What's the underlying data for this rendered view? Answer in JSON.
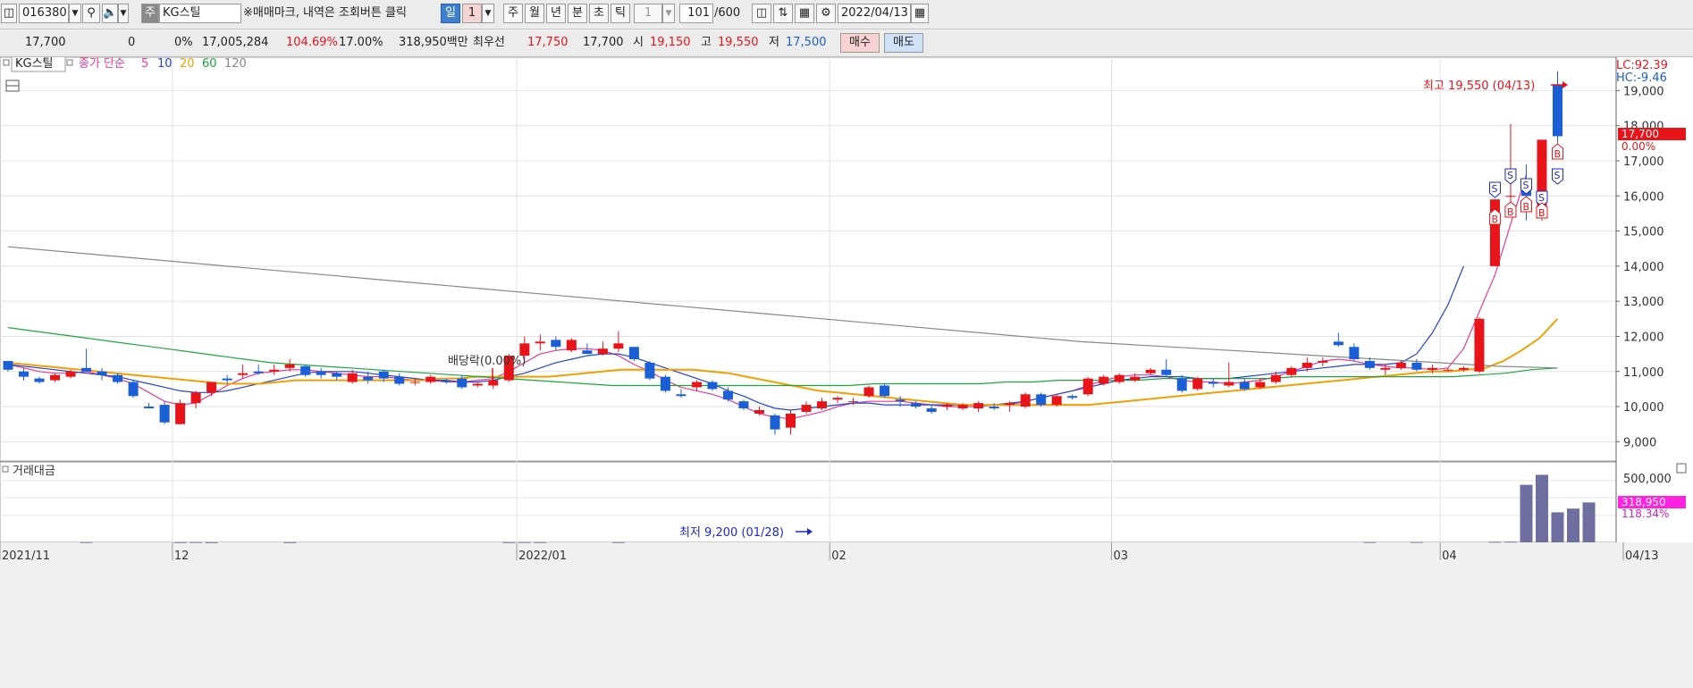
{
  "toolbar": {
    "code": "016380",
    "stock_badge": "주",
    "stock_name": "KG스틸",
    "notice": "※매매마크, 내역은 조회버튼 클릭",
    "periods": [
      "일",
      "1",
      "주",
      "월",
      "년",
      "분",
      "초",
      "틱",
      "1"
    ],
    "count": "101",
    "count_max": "/600",
    "date": "2022/04/13"
  },
  "quote": {
    "price": "17,700",
    "change": "0",
    "change_pct": "0%",
    "volume": "17,005,284",
    "vol_ratio": "104.69%",
    "turnover": "17.00%",
    "amount": "318,950백만",
    "best_label": "최우선",
    "best_ask": "17,750",
    "best_bid": "17,700",
    "open_label": "시",
    "open": "19,150",
    "high_label": "고",
    "high": "19,550",
    "low_label": "저",
    "low": "17,500",
    "buy_label": "매수",
    "sell_label": "매도"
  },
  "legend": {
    "stock": "KG스틸",
    "ma_prefix": "종가 단순",
    "ma": [
      {
        "label": "5",
        "color": "#e6399b"
      },
      {
        "label": "10",
        "color": "#2244cc"
      },
      {
        "label": "20",
        "color": "#f0a000"
      },
      {
        "label": "60",
        "color": "#1aa83a"
      },
      {
        "label": "120",
        "color": "#888888"
      }
    ],
    "volume_title": "거래대금"
  },
  "annotations": {
    "high": "최고 19,550 (04/13)",
    "low": "최저 9,200 (01/28)",
    "dividend": "배당락(0.00%)",
    "lc": "LC:92.39",
    "hc": "HC:-9.46",
    "price_tag": "17,700",
    "price_tag_pct": "0.00%",
    "vol_tag": "318,950",
    "vol_tag_pct": "118.34%"
  },
  "colors": {
    "up": "#e8141a",
    "down": "#1a5fd6",
    "volume": "#6e6ea0"
  },
  "chart_data": {
    "type": "candlestick",
    "y_ticks": [
      "19,000",
      "18,000",
      "17,000",
      "16,000",
      "15,000",
      "14,000",
      "13,000",
      "12,000",
      "11,000",
      "10,000",
      "9,000"
    ],
    "y_tick_values": [
      19000,
      18000,
      17000,
      16000,
      15000,
      14000,
      13000,
      12000,
      11000,
      10000,
      9000
    ],
    "ylim": [
      8500,
      19900
    ],
    "x_labels": [
      {
        "label": "2021/11",
        "index": -1
      },
      {
        "label": "12",
        "index": 11
      },
      {
        "label": "2022/01",
        "index": 33
      },
      {
        "label": "02",
        "index": 53
      },
      {
        "label": "03",
        "index": 71
      },
      {
        "label": "04",
        "index": 92
      },
      {
        "label": "04/13",
        "index": 101
      }
    ],
    "candles": [
      [
        11300,
        11300,
        11000,
        11050
      ],
      [
        11000,
        11100,
        10750,
        10850
      ],
      [
        10800,
        10850,
        10650,
        10700
      ],
      [
        10750,
        10950,
        10700,
        10900
      ],
      [
        10850,
        11050,
        10800,
        11000
      ],
      [
        11100,
        11650,
        11000,
        11000
      ],
      [
        11000,
        11100,
        10750,
        10900
      ],
      [
        10900,
        10950,
        10650,
        10700
      ],
      [
        10700,
        10750,
        10250,
        10300
      ],
      [
        10000,
        10100,
        9950,
        9950
      ],
      [
        10050,
        10150,
        9500,
        9550
      ],
      [
        9500,
        10200,
        9500,
        10100
      ],
      [
        10100,
        10450,
        9950,
        10400
      ],
      [
        10400,
        10700,
        10300,
        10700
      ],
      [
        10800,
        10900,
        10650,
        10750
      ],
      [
        10900,
        11200,
        10800,
        10950
      ],
      [
        11000,
        11200,
        10900,
        10950
      ],
      [
        11000,
        11200,
        10900,
        11050
      ],
      [
        11100,
        11350,
        11000,
        11200
      ],
      [
        11150,
        11200,
        10850,
        10900
      ],
      [
        11000,
        11100,
        10800,
        10900
      ],
      [
        10950,
        11000,
        10750,
        10850
      ],
      [
        10700,
        11050,
        10650,
        10950
      ],
      [
        10850,
        11000,
        10650,
        10750
      ],
      [
        11000,
        11050,
        10700,
        10800
      ],
      [
        10850,
        10950,
        10600,
        10650
      ],
      [
        10700,
        10800,
        10600,
        10700
      ],
      [
        10700,
        10900,
        10650,
        10850
      ],
      [
        10750,
        10800,
        10650,
        10700
      ],
      [
        10800,
        10900,
        10500,
        10550
      ],
      [
        10600,
        10700,
        10550,
        10650
      ],
      [
        10600,
        10800,
        10500,
        10750
      ],
      [
        10750,
        11500,
        10700,
        11450
      ],
      [
        11450,
        12000,
        11350,
        11800
      ],
      [
        11800,
        12050,
        11600,
        11850
      ],
      [
        11900,
        12000,
        11600,
        11700
      ],
      [
        11600,
        11950,
        11550,
        11900
      ],
      [
        11600,
        11800,
        11500,
        11500
      ],
      [
        11500,
        11850,
        11450,
        11650
      ],
      [
        11650,
        12150,
        11550,
        11800
      ],
      [
        11700,
        11700,
        11300,
        11350
      ],
      [
        11250,
        11300,
        10750,
        10800
      ],
      [
        10850,
        10900,
        10400,
        10450
      ],
      [
        10350,
        10500,
        10250,
        10300
      ],
      [
        10550,
        10750,
        10450,
        10700
      ],
      [
        10700,
        10750,
        10450,
        10500
      ],
      [
        10450,
        10550,
        10150,
        10200
      ],
      [
        10150,
        10200,
        9900,
        9950
      ],
      [
        9800,
        10000,
        9750,
        9900
      ],
      [
        9750,
        9800,
        9200,
        9350
      ],
      [
        9400,
        9900,
        9200,
        9800
      ],
      [
        9850,
        10150,
        9800,
        10050
      ],
      [
        9950,
        10250,
        9900,
        10150
      ],
      [
        10200,
        10300,
        10100,
        10250
      ],
      [
        10150,
        10250,
        10050,
        10150
      ],
      [
        10300,
        10600,
        10250,
        10550
      ],
      [
        10600,
        10650,
        10250,
        10300
      ],
      [
        10200,
        10300,
        10000,
        10150
      ],
      [
        10100,
        10150,
        9950,
        10000
      ],
      [
        9950,
        10050,
        9800,
        9850
      ],
      [
        10000,
        10100,
        9900,
        10050
      ],
      [
        9950,
        10100,
        9900,
        10050
      ],
      [
        9950,
        10150,
        9850,
        10100
      ],
      [
        10000,
        10100,
        9900,
        9950
      ],
      [
        10050,
        10150,
        9850,
        10100
      ],
      [
        10000,
        10400,
        9950,
        10350
      ],
      [
        10350,
        10400,
        10000,
        10050
      ],
      [
        10050,
        10350,
        10000,
        10300
      ],
      [
        10300,
        10350,
        10200,
        10250
      ],
      [
        10350,
        10850,
        10300,
        10800
      ],
      [
        10650,
        10900,
        10600,
        10850
      ],
      [
        10700,
        10950,
        10650,
        10900
      ],
      [
        10750,
        10950,
        10700,
        10850
      ],
      [
        10950,
        11100,
        10900,
        11050
      ],
      [
        11050,
        11350,
        10850,
        10900
      ],
      [
        10800,
        10900,
        10400,
        10450
      ],
      [
        10500,
        10850,
        10450,
        10800
      ],
      [
        10700,
        10800,
        10550,
        10650
      ],
      [
        10600,
        11250,
        10550,
        10700
      ],
      [
        10700,
        10800,
        10450,
        10500
      ],
      [
        10550,
        10800,
        10500,
        10700
      ],
      [
        10700,
        11000,
        10650,
        10900
      ],
      [
        10900,
        11150,
        10850,
        11100
      ],
      [
        11100,
        11400,
        11000,
        11250
      ],
      [
        11250,
        11400,
        11150,
        11300
      ],
      [
        11850,
        12100,
        11700,
        11750
      ],
      [
        11700,
        11800,
        11300,
        11350
      ],
      [
        11300,
        11400,
        11050,
        11100
      ],
      [
        11050,
        11200,
        10900,
        11100
      ],
      [
        11100,
        11300,
        11050,
        11250
      ],
      [
        11250,
        11350,
        11000,
        11050
      ],
      [
        11050,
        11200,
        10950,
        11100
      ],
      [
        11050,
        11100,
        11000,
        11050
      ],
      [
        11050,
        11150,
        11000,
        11100
      ],
      [
        11000,
        12550,
        10950,
        12500
      ],
      [
        14000,
        15900,
        14000,
        15900
      ],
      [
        16000,
        18050,
        15450,
        16000
      ],
      [
        16350,
        16900,
        15300,
        16000
      ],
      [
        15500,
        17600,
        15300,
        17600
      ],
      [
        19150,
        19550,
        17500,
        17700
      ]
    ],
    "volume_label": "500,000",
    "volume": [
      0,
      0,
      0,
      0,
      0,
      2500,
      0,
      0,
      0,
      0,
      0,
      2000,
      3000,
      1500,
      0,
      0,
      0,
      0,
      1500,
      0,
      0,
      0,
      0,
      0,
      0,
      0,
      0,
      0,
      0,
      0,
      0,
      0,
      2000,
      3000,
      2500,
      0,
      0,
      0,
      0,
      2500,
      0,
      0,
      0,
      0,
      0,
      0,
      0,
      0,
      0,
      0,
      0,
      0,
      0,
      0,
      0,
      0,
      0,
      0,
      0,
      0,
      0,
      0,
      0,
      0,
      0,
      0,
      0,
      0,
      0,
      0,
      0,
      0,
      0,
      0,
      0,
      0,
      0,
      0,
      0,
      0,
      0,
      0,
      0,
      0,
      0,
      0,
      0,
      3000,
      0,
      0,
      3500,
      0,
      0,
      0,
      0,
      5000,
      6000,
      460000,
      540000,
      240000,
      270000,
      318950
    ],
    "volume_max": 600000,
    "ma": {
      "5": {
        "start": 0,
        "values": [
          11200,
          11100,
          11000,
          10950,
          10950,
          11000,
          10900,
          10800,
          10650,
          10400,
          10150,
          10050,
          10100,
          10350,
          10600,
          10800,
          10950,
          11000,
          11050,
          11050,
          11000,
          10950,
          10900,
          10850,
          10850,
          10800,
          10750,
          10750,
          10700,
          10700,
          10750,
          10800,
          11000,
          11250,
          11500,
          11600,
          11650,
          11650,
          11600,
          11450,
          11200,
          11000,
          10750,
          10550,
          10450,
          10350,
          10200,
          10000,
          9800,
          9700,
          9650,
          9750,
          9850,
          10000,
          10100,
          10150,
          10150,
          10150,
          10100,
          10050,
          10000,
          10000,
          10000,
          10050,
          10050,
          10150,
          10250,
          10350,
          10450,
          10600,
          10750,
          10850,
          10900,
          10900,
          10850,
          10750,
          10700,
          10700,
          10650,
          10700,
          10750,
          10850,
          11000,
          11150,
          11300,
          11350,
          11300,
          11200,
          11150,
          11100,
          11100,
          11050,
          11100,
          11650,
          12700,
          13750,
          15200,
          16600
        ]
      },
      "10": {
        "start": 0,
        "values": [
          11200,
          11150,
          11100,
          11050,
          11000,
          10950,
          10900,
          10850,
          10750,
          10650,
          10550,
          10450,
          10400,
          10400,
          10450,
          10550,
          10650,
          10750,
          10850,
          10950,
          11000,
          11000,
          11000,
          10950,
          10900,
          10850,
          10800,
          10750,
          10750,
          10700,
          10700,
          10750,
          10850,
          10950,
          11100,
          11250,
          11350,
          11450,
          11500,
          11500,
          11400,
          11250,
          11100,
          10950,
          10800,
          10650,
          10450,
          10300,
          10100,
          9950,
          9900,
          9950,
          10000,
          10050,
          10100,
          10100,
          10050,
          10050,
          10050,
          10050,
          10050,
          10050,
          10050,
          10050,
          10100,
          10150,
          10250,
          10350,
          10450,
          10550,
          10650,
          10750,
          10800,
          10850,
          10850,
          10850,
          10800,
          10800,
          10800,
          10850,
          10900,
          10950,
          11000,
          11050,
          11100,
          11150,
          11200,
          11200,
          11200,
          11250,
          11500,
          12100,
          12900,
          14000
        ]
      },
      "20": {
        "start": 0,
        "values": [
          11250,
          11200,
          11150,
          11100,
          11050,
          11000,
          10950,
          10900,
          10850,
          10800,
          10750,
          10700,
          10650,
          10650,
          10650,
          10700,
          10750,
          10750,
          10750,
          10750,
          10750,
          10750,
          10750,
          10750,
          10800,
          10800,
          10850,
          10850,
          10850,
          10850,
          10850,
          10900,
          10950,
          11000,
          11050,
          11050,
          11050,
          11050,
          11050,
          11000,
          10950,
          10850,
          10750,
          10650,
          10550,
          10450,
          10400,
          10350,
          10300,
          10250,
          10200,
          10150,
          10100,
          10050,
          10050,
          10050,
          10050,
          10050,
          10050,
          10050,
          10050,
          10100,
          10150,
          10200,
          10250,
          10300,
          10350,
          10400,
          10450,
          10500,
          10550,
          10600,
          10650,
          10700,
          10750,
          10800,
          10850,
          10900,
          10950,
          11000,
          11000,
          11050,
          11100,
          11300,
          11600,
          11950,
          12500
        ]
      },
      "60": {
        "start": 0,
        "values": [
          12250,
          12150,
          12050,
          11950,
          11850,
          11750,
          11650,
          11550,
          11450,
          11350,
          11250,
          11200,
          11150,
          11100,
          11050,
          11000,
          10950,
          10900,
          10850,
          10800,
          10750,
          10700,
          10650,
          10600,
          10600,
          10600,
          10600,
          10600,
          10600,
          10600,
          10600,
          10600,
          10600,
          10650,
          10650,
          10650,
          10650,
          10650,
          10700,
          10700,
          10750,
          10750,
          10750,
          10750,
          10800,
          10800,
          10800,
          10800,
          10800,
          10850,
          10850,
          10850,
          10850,
          10850,
          10850,
          10850,
          10900,
          10950,
          11050,
          11100
        ]
      },
      "120": {
        "start": 0,
        "values": [
          14550,
          14400,
          14250,
          14100,
          13950,
          13800,
          13650,
          13500,
          13350,
          13200,
          13050,
          12900,
          12750,
          12600,
          12450,
          12300,
          12150,
          12000,
          11850,
          11750,
          11650,
          11550,
          11450,
          11350,
          11250,
          11150,
          11100
        ]
      }
    },
    "signals": [
      {
        "index": 95,
        "type": "S"
      },
      {
        "index": 95,
        "type": "B"
      },
      {
        "index": 96,
        "type": "S"
      },
      {
        "index": 96,
        "type": "B"
      },
      {
        "index": 97,
        "type": "S"
      },
      {
        "index": 97,
        "type": "B"
      },
      {
        "index": 98,
        "type": "S"
      },
      {
        "index": 98,
        "type": "B"
      },
      {
        "index": 99,
        "type": "S"
      },
      {
        "index": 99,
        "type": "B"
      }
    ]
  }
}
